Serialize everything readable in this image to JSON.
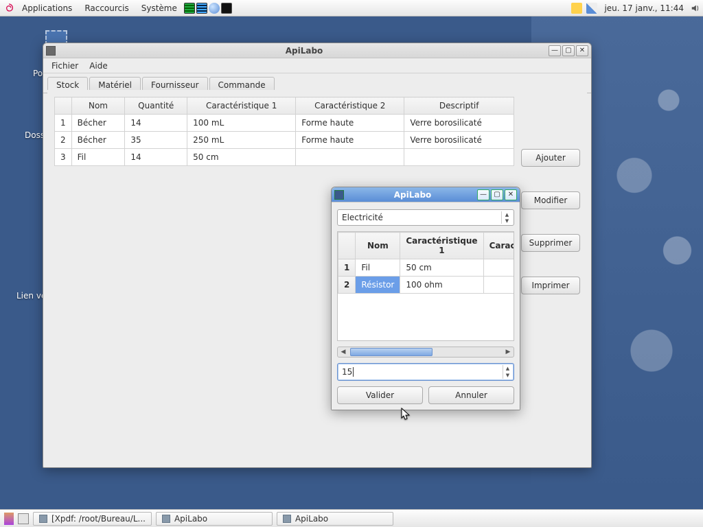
{
  "panel": {
    "menus": [
      "Applications",
      "Raccourcis",
      "Système"
    ],
    "clock": "jeu. 17 janv., 11:44"
  },
  "desktop": {
    "labels": [
      "Pos",
      "Doss",
      "Lien ve"
    ]
  },
  "mainwin": {
    "title": "ApiLabo",
    "menus": [
      "Fichier",
      "Aide"
    ],
    "tabs": [
      "Stock",
      "Matériel",
      "Fournisseur",
      "Commande"
    ],
    "active_tab": 0,
    "columns": [
      "",
      "Nom",
      "Quantité",
      "Caractéristique 1",
      "Caractéristique 2",
      "Descriptif"
    ],
    "rows": [
      [
        "1",
        "Bécher",
        "14",
        "100 mL",
        "Forme haute",
        "Verre borosilicaté"
      ],
      [
        "2",
        "Bécher",
        "35",
        "250 mL",
        "Forme haute",
        "Verre borosilicaté"
      ],
      [
        "3",
        "Fil",
        "14",
        "50 cm",
        "",
        ""
      ]
    ],
    "buttons": [
      "Ajouter",
      "Modifier",
      "Supprimer",
      "Imprimer"
    ]
  },
  "dialog": {
    "title": "ApiLabo",
    "category": "Electricité",
    "columns": [
      "",
      "Nom",
      "Caractéristique 1",
      "Carac"
    ],
    "rows": [
      [
        "1",
        "Fil",
        "50 cm",
        ""
      ],
      [
        "2",
        "Résistor",
        "100 ohm",
        ""
      ]
    ],
    "selected_row": 1,
    "input_value": "15",
    "buttons": [
      "Valider",
      "Annuler"
    ]
  },
  "taskbar": {
    "tasks": [
      "[Xpdf: /root/Bureau/L...",
      "ApiLabo",
      "ApiLabo"
    ]
  }
}
